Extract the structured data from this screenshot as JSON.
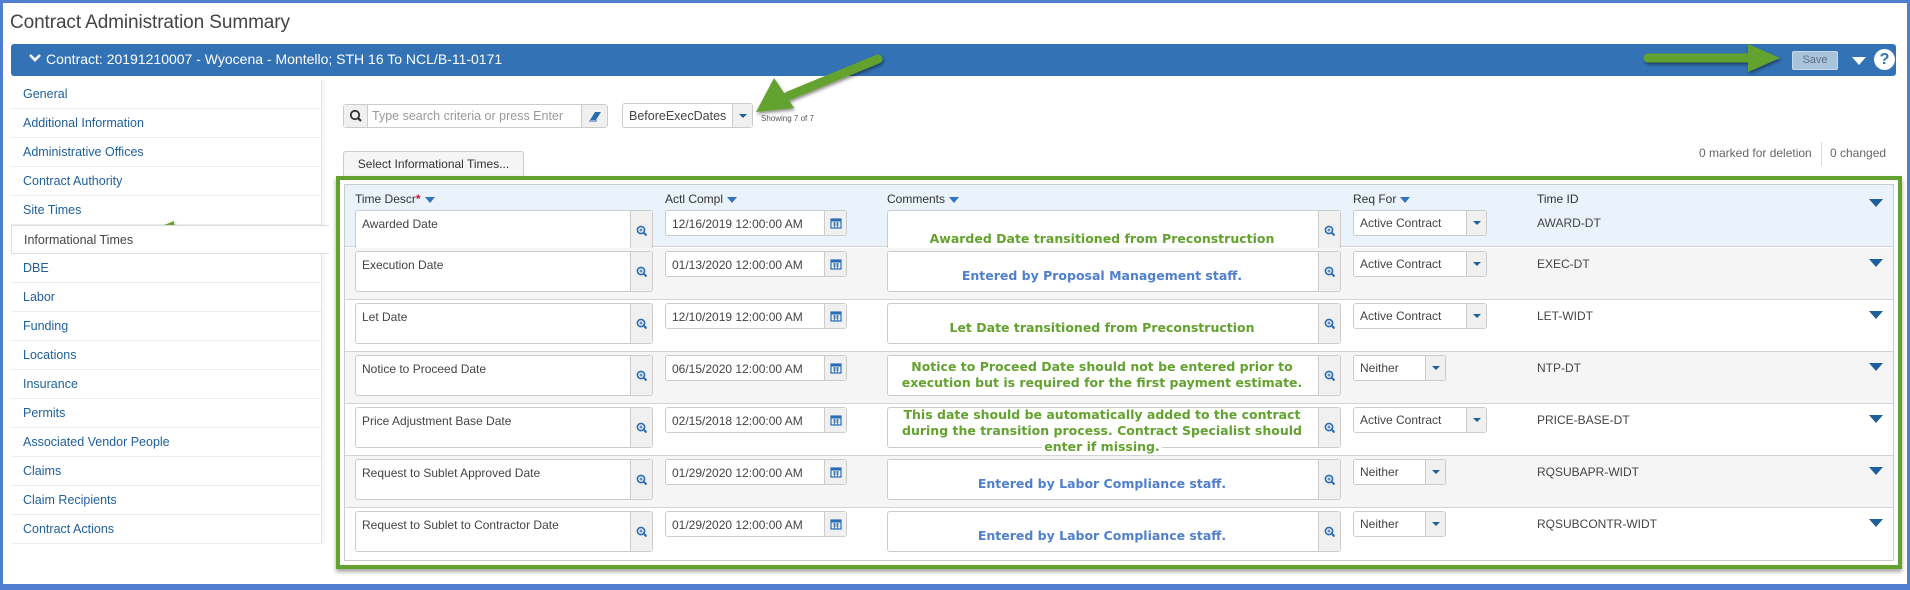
{
  "page": {
    "title": "Contract Administration Summary"
  },
  "contract_bar": {
    "title": "Contract: 20191210007 - Wyocena - Montello; STH 16 To NCL/B-11-0171",
    "save_label": "Save",
    "help_label": "?"
  },
  "sidebar": {
    "items": [
      {
        "label": "General",
        "active": false
      },
      {
        "label": "Additional Information",
        "active": false
      },
      {
        "label": "Administrative Offices",
        "active": false
      },
      {
        "label": "Contract Authority",
        "active": false
      },
      {
        "label": "Site Times",
        "active": false
      },
      {
        "label": "Informational Times",
        "active": true
      },
      {
        "label": "DBE",
        "active": false
      },
      {
        "label": "Labor",
        "active": false
      },
      {
        "label": "Funding",
        "active": false
      },
      {
        "label": "Locations",
        "active": false
      },
      {
        "label": "Insurance",
        "active": false
      },
      {
        "label": "Permits",
        "active": false
      },
      {
        "label": "Associated Vendor People",
        "active": false
      },
      {
        "label": "Claims",
        "active": false
      },
      {
        "label": "Claim Recipients",
        "active": false
      },
      {
        "label": "Contract Actions",
        "active": false
      }
    ]
  },
  "toolbar": {
    "search_placeholder": "Type search criteria or press Enter",
    "search_value": "",
    "view_selected": "BeforeExecDates",
    "showing": "Showing 7 of 7",
    "select_button": "Select Informational Times...",
    "marked_for_deletion": "0 marked for deletion",
    "changed": "0 changed"
  },
  "grid": {
    "columns": {
      "time_descr": "Time Descr",
      "required_marker": "*",
      "actl_compl": "Actl Compl",
      "comments": "Comments",
      "req_for": "Req For",
      "time_id": "Time ID"
    },
    "rows": [
      {
        "descr": "Awarded Date",
        "date": "12/16/2019 12:00:00 AM",
        "comment": "Awarded Date transitioned from Preconstruction",
        "comment_color": "green",
        "req_for": "Active Contract",
        "time_id": "AWARD-DT"
      },
      {
        "descr": "Execution Date",
        "date": "01/13/2020 12:00:00 AM",
        "comment": "Entered by Proposal Management staff.",
        "comment_color": "blue",
        "req_for": "Active Contract",
        "time_id": "EXEC-DT"
      },
      {
        "descr": "Let Date",
        "date": "12/10/2019 12:00:00 AM",
        "comment": "Let Date transitioned from Preconstruction",
        "comment_color": "green",
        "req_for": "Active Contract",
        "time_id": "LET-WIDT"
      },
      {
        "descr": "Notice to Proceed Date",
        "date": "06/15/2020 12:00:00 AM",
        "comment": "Notice to Proceed Date should not be entered prior to execution but is required for the first payment estimate.",
        "comment_color": "green",
        "req_for": "Neither",
        "time_id": "NTP-DT"
      },
      {
        "descr": "Price Adjustment Base Date",
        "date": "02/15/2018 12:00:00 AM",
        "comment": "This date should be automatically added to the contract during the transition process. Contract Specialist should enter if missing.",
        "comment_color": "green",
        "req_for": "Active Contract",
        "time_id": "PRICE-BASE-DT"
      },
      {
        "descr": "Request to Sublet Approved Date",
        "date": "01/29/2020 12:00:00 AM",
        "comment": "Entered by Labor Compliance staff.",
        "comment_color": "blue",
        "req_for": "Neither",
        "time_id": "RQSUBAPR-WIDT"
      },
      {
        "descr": "Request to Sublet to Contractor Date",
        "date": "01/29/2020 12:00:00 AM",
        "comment": "Entered by Labor Compliance staff.",
        "comment_color": "blue",
        "req_for": "Neither",
        "time_id": "RQSUBCONTR-WIDT"
      }
    ]
  },
  "comment_lines": {
    "ntp_line1": "Notice to Proceed Date should not be entered prior to",
    "ntp_line2": "execution but is required for the first payment estimate.",
    "price_line1": "This date should be automatically added to the contract",
    "price_line2": "during the transition process. Contract Specialist should",
    "price_line3": "enter if missing."
  },
  "colors": {
    "frame": "#4f7fce",
    "header_bar": "#3372b4",
    "annotation_green": "#63a22f",
    "link_blue": "#1f5f9c",
    "comment_blue": "#4f7fce"
  }
}
